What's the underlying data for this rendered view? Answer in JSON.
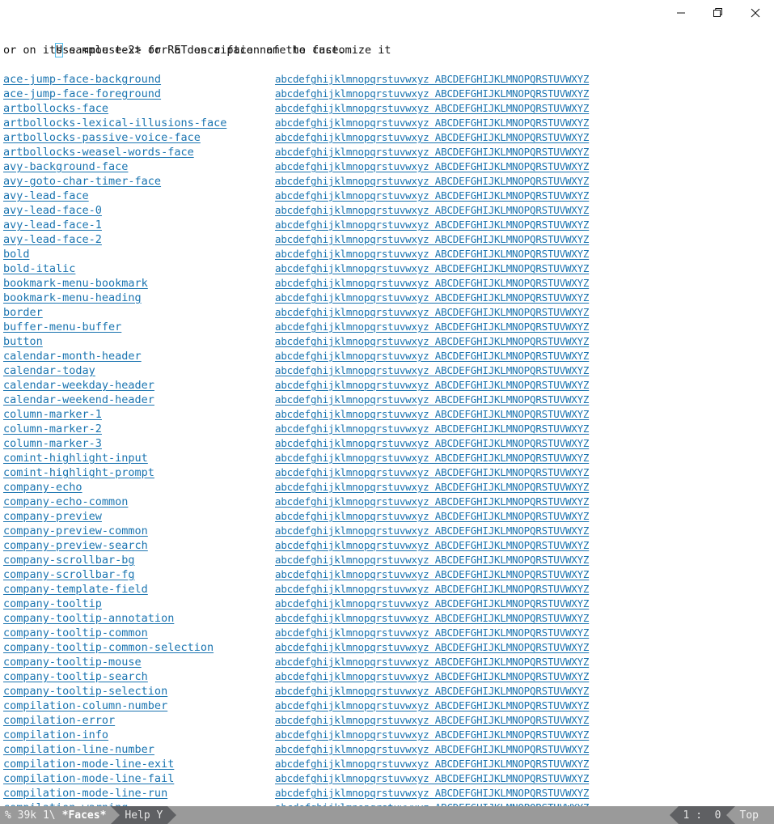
{
  "window": {
    "title": "*Faces*",
    "controls": [
      {
        "name": "minimize",
        "label": "Minimize",
        "glyph": "minimize-icon"
      },
      {
        "name": "restore",
        "label": "Restore",
        "glyph": "restore-icon"
      },
      {
        "name": "close",
        "label": "Close",
        "glyph": "close-icon"
      }
    ]
  },
  "colors": {
    "link": "#1a74b0",
    "text": "#101010",
    "background": "#ffffff",
    "cursor": "#4db8e8",
    "modeline_light": "#9a9a9a",
    "modeline_dark": "#5f6063"
  },
  "buffer": {
    "header_lines": [
      "Use <mouse-2> or RET on a face name to customize it",
      "or on its sample text for a description of the face."
    ],
    "cursor_char": "U",
    "sample_text": "abcdefghijklmnopqrstuvwxyz ABCDEFGHIJKLMNOPQRSTUVWXYZ",
    "faces": [
      "ace-jump-face-background",
      "ace-jump-face-foreground",
      "artbollocks-face",
      "artbollocks-lexical-illusions-face",
      "artbollocks-passive-voice-face",
      "artbollocks-weasel-words-face",
      "avy-background-face",
      "avy-goto-char-timer-face",
      "avy-lead-face",
      "avy-lead-face-0",
      "avy-lead-face-1",
      "avy-lead-face-2",
      "bold",
      "bold-italic",
      "bookmark-menu-bookmark",
      "bookmark-menu-heading",
      "border",
      "buffer-menu-buffer",
      "button",
      "calendar-month-header",
      "calendar-today",
      "calendar-weekday-header",
      "calendar-weekend-header",
      "column-marker-1",
      "column-marker-2",
      "column-marker-3",
      "comint-highlight-input",
      "comint-highlight-prompt",
      "company-echo",
      "company-echo-common",
      "company-preview",
      "company-preview-common",
      "company-preview-search",
      "company-scrollbar-bg",
      "company-scrollbar-fg",
      "company-template-field",
      "company-tooltip",
      "company-tooltip-annotation",
      "company-tooltip-common",
      "company-tooltip-common-selection",
      "company-tooltip-mouse",
      "company-tooltip-search",
      "company-tooltip-selection",
      "compilation-column-number",
      "compilation-error",
      "compilation-info",
      "compilation-line-number",
      "compilation-mode-line-exit",
      "compilation-mode-line-fail",
      "compilation-mode-line-run",
      "compilation-warning"
    ]
  },
  "modeline": {
    "left": {
      "status": "% 39k 1\\",
      "buffer_name": "*Faces*",
      "major_mode": "Help Y"
    },
    "right": {
      "position": "1 :  0",
      "scroll": "Top"
    }
  }
}
